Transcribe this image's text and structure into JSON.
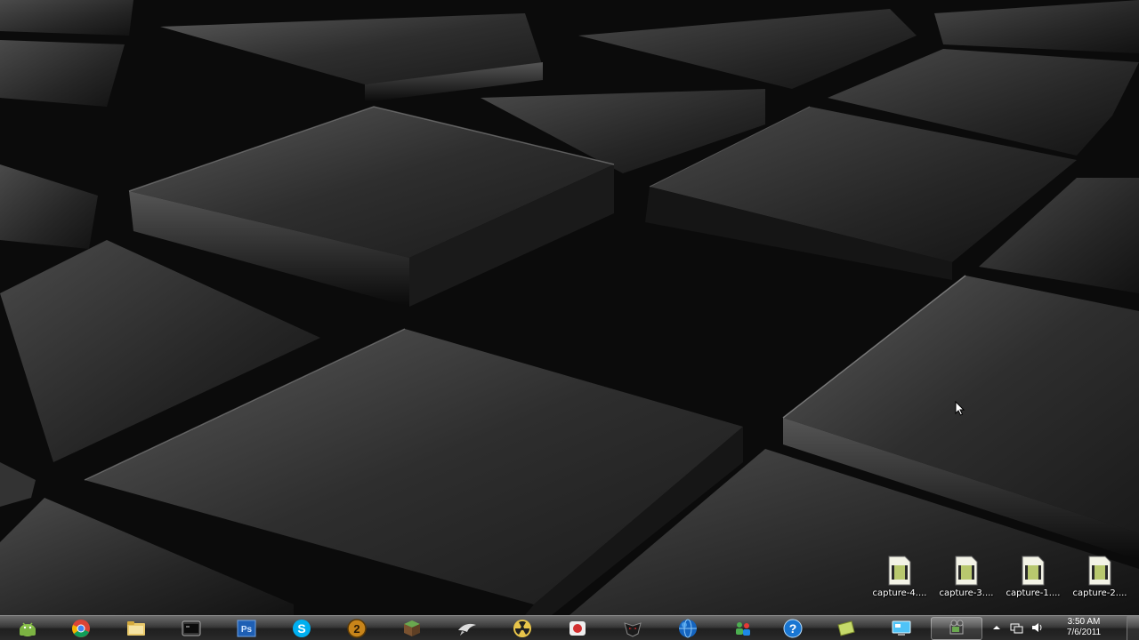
{
  "desktop": {
    "icons": [
      {
        "label": "capture-4...."
      },
      {
        "label": "capture-3...."
      },
      {
        "label": "capture-1...."
      },
      {
        "label": "capture-2...."
      }
    ]
  },
  "taskbar": {
    "start": {
      "icon": "android-start-orb-icon"
    },
    "pinned": [
      {
        "name": "chrome-icon"
      },
      {
        "name": "file-explorer-icon"
      },
      {
        "name": "terminal-icon"
      },
      {
        "name": "photoshop-icon",
        "text": "Ps"
      },
      {
        "name": "skype-icon",
        "text": "S"
      },
      {
        "name": "game-2-icon",
        "text": "2"
      },
      {
        "name": "minecraft-icon"
      },
      {
        "name": "bird-app-icon"
      },
      {
        "name": "radiation-app-icon"
      },
      {
        "name": "red-record-app-icon"
      },
      {
        "name": "dark-mask-app-icon"
      },
      {
        "name": "globe-app-icon"
      },
      {
        "name": "network-users-icon"
      },
      {
        "name": "help-icon",
        "text": "?"
      },
      {
        "name": "green-folder-icon"
      },
      {
        "name": "remote-desktop-icon"
      },
      {
        "name": "media-app-icon"
      }
    ],
    "tray": {
      "expand_icon": "up-arrow-icon",
      "network_icon": "network-icon",
      "volume_icon": "volume-icon",
      "time": "3:50 AM",
      "date": "7/6/2011"
    }
  },
  "colors": {
    "taskbar": "#2a2a2a",
    "accent_chrome_red": "#db4437",
    "photoshop_blue": "#1e5fb4",
    "skype_blue": "#00aff0"
  }
}
